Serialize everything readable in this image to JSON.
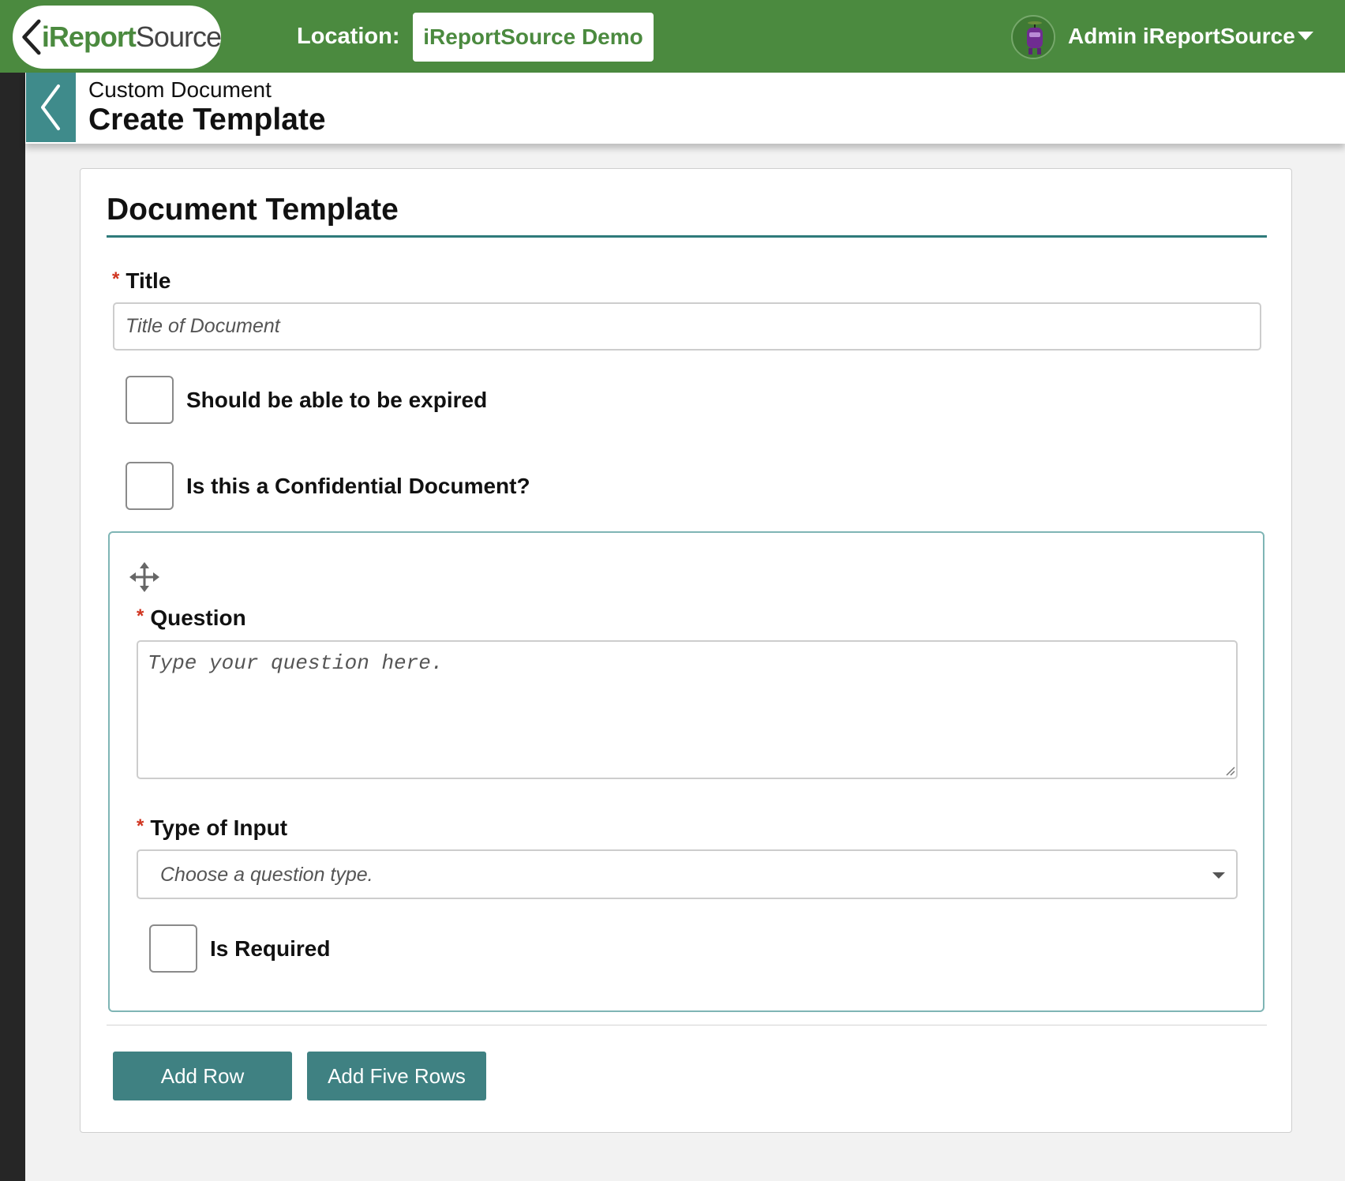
{
  "header": {
    "logo": {
      "text_bold": "iReport",
      "text_regular": "Source"
    },
    "location_label": "Location:",
    "location_value": "iReportSource Demo",
    "user_name": "Admin iReportSource"
  },
  "subheader": {
    "breadcrumb": "Custom Document",
    "title": "Create Template"
  },
  "form": {
    "section_title": "Document Template",
    "title_field": {
      "label": "Title",
      "placeholder": "Title of Document",
      "value": ""
    },
    "checkboxes": {
      "expirable": {
        "label": "Should be able to be expired",
        "checked": false
      },
      "confidential": {
        "label": "Is this a Confidential Document?",
        "checked": false
      }
    },
    "question_row": {
      "question_label": "Question",
      "question_placeholder": "Type your question here.",
      "input_type_label": "Type of Input",
      "input_type_placeholder": "Choose a question type.",
      "required_label": "Is Required",
      "required_checked": false
    },
    "buttons": {
      "add_row": "Add Row",
      "add_five_rows": "Add Five Rows"
    }
  },
  "icons": {
    "back": "chevron-left-icon",
    "drag": "move-arrows-icon",
    "user_menu": "caret-down-icon",
    "select": "caret-down-icon"
  },
  "colors": {
    "brand_green": "#4b8a3f",
    "teal": "#3f8182",
    "required": "#d0341f"
  }
}
